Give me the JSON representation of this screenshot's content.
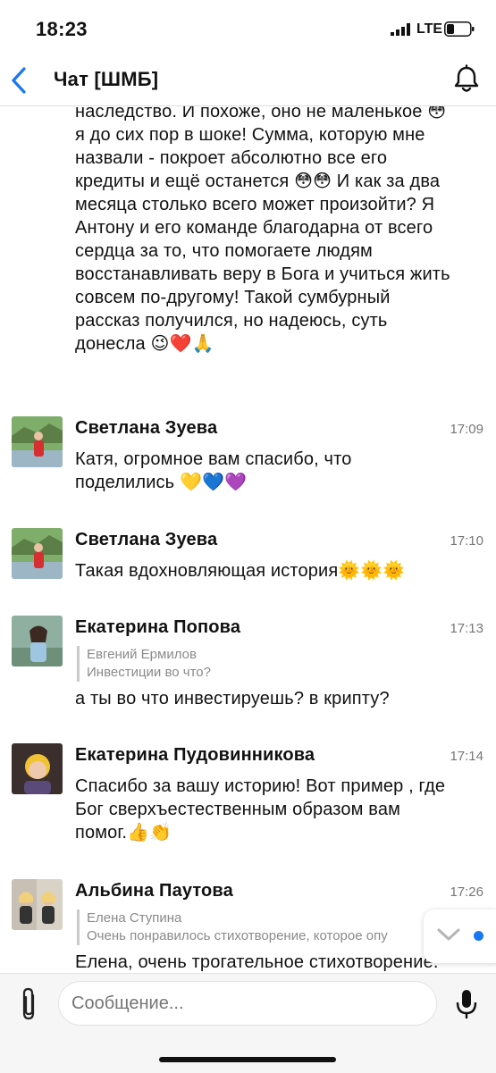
{
  "status_bar": {
    "time": "18:23",
    "network": "LTE"
  },
  "header": {
    "title": "Чат [ШМБ]"
  },
  "continued_message": {
    "lines": [
      "наследство. И похоже, оно не маленькое 😳",
      "я до сих пор в шоке! Сумма, которую мне",
      "назвали - покроет абсолютно все его",
      "кредиты и ещё останется 😳😳 И как за два",
      "месяца столько всего может произойти? Я",
      "Антону и его команде благодарна от всего",
      "сердца за то, что помогаете людям",
      "восстанавливать веру в Бога и учиться жить",
      "совсем по-другому! Такой сумбурный",
      "рассказ получился, но надеюсь, суть",
      "донесла 😉❤️🙏"
    ]
  },
  "messages": [
    {
      "author": "Светлана Зуева",
      "time": "17:09",
      "lines": [
        "Катя, огромное вам спасибо, что",
        "поделились 💛💙💜"
      ]
    },
    {
      "author": "Светлана Зуева",
      "time": "17:10",
      "lines": [
        "Такая вдохновляющая история🌞🌞🌞"
      ]
    },
    {
      "author": "Екатерина Попова",
      "time": "17:13",
      "quote_author": "Евгений Ермилов",
      "quote_text": "Инвестиции во что?",
      "lines": [
        "а ты во что инвестируешь? в крипту?"
      ]
    },
    {
      "author": "Екатерина Пудовинникова",
      "time": "17:14",
      "lines": [
        "Спасибо за вашу историю! Вот пример , где",
        "Бог сверхъестественным образом вам",
        "помог.👍👏"
      ]
    },
    {
      "author": "Альбина Паутова",
      "time": "17:26",
      "quote_author": "Елена Ступина",
      "quote_text": "Очень понравилось стихотворение, которое опу",
      "lines": [
        "Елена, очень трогательное стихотворение."
      ]
    }
  ],
  "composer": {
    "placeholder": "Сообщение..."
  },
  "colors": {
    "accent": "#1877f2",
    "secondary_text": "#777777"
  }
}
